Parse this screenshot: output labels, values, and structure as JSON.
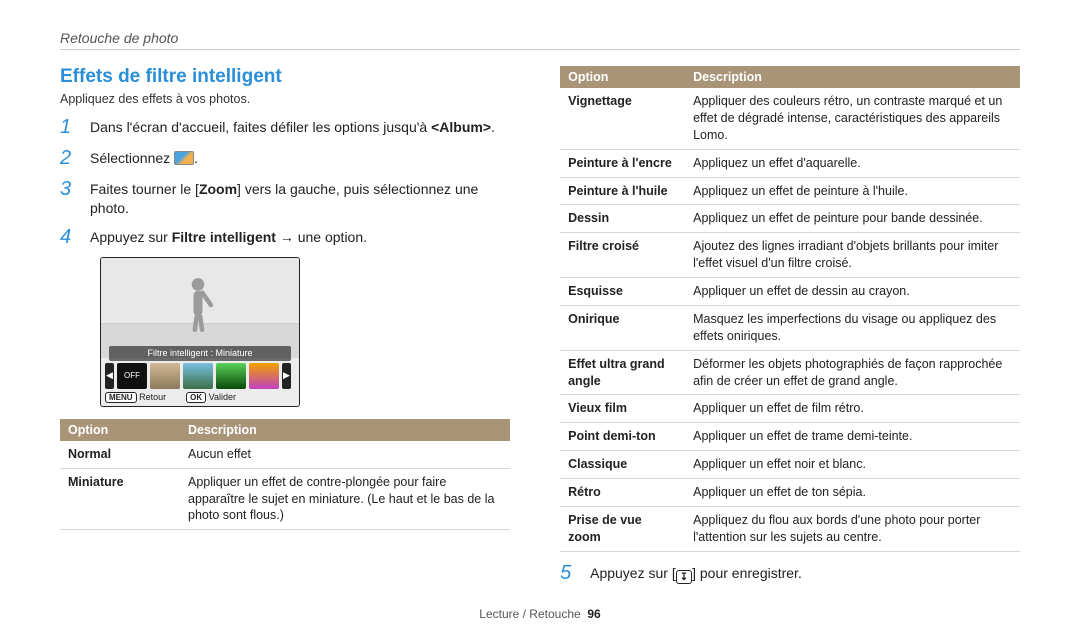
{
  "breadcrumb": "Retouche de photo",
  "heading": "Effets de filtre intelligent",
  "subtext": "Appliquez des effets à vos photos.",
  "steps": {
    "s1_a": "Dans l'écran d'accueil, faites défiler les options jusqu'à ",
    "s1_b": "<Album>",
    "s1_c": ".",
    "s2_a": "Sélectionnez ",
    "s2_b": ".",
    "s3_a": "Faites tourner le [",
    "s3_b": "Zoom",
    "s3_c": "] vers la gauche, puis sélectionnez une photo.",
    "s4_a": "Appuyez sur ",
    "s4_b": "Filtre intelligent",
    "s4_c": " → une option.",
    "s5_a": "Appuyez sur [",
    "s5_icon": "↧",
    "s5_b": "] pour enregistrer."
  },
  "preview": {
    "strip_label": "Filtre intelligent : Miniature",
    "off": "OFF",
    "nav_left": "◀",
    "nav_right": "▶",
    "menu_pill": "MENU",
    "menu_txt": "Retour",
    "ok_pill": "OK",
    "ok_txt": "Valider"
  },
  "table_header": {
    "option": "Option",
    "description": "Description"
  },
  "table_left": [
    {
      "opt": "Normal",
      "desc": "Aucun effet"
    },
    {
      "opt": "Miniature",
      "desc": "Appliquer un effet de contre-plongée pour faire apparaître le sujet en miniature. (Le haut et le bas de la photo sont flous.)"
    }
  ],
  "table_right": [
    {
      "opt": "Vignettage",
      "desc": "Appliquer des couleurs rétro, un contraste marqué et un effet de dégradé intense, caractéristiques des appareils Lomo."
    },
    {
      "opt": "Peinture à l'encre",
      "desc": "Appliquez un effet d'aquarelle."
    },
    {
      "opt": "Peinture à l'huile",
      "desc": "Appliquez un effet de peinture à l'huile."
    },
    {
      "opt": "Dessin",
      "desc": "Appliquez un effet de peinture pour bande dessinée."
    },
    {
      "opt": "Filtre croisé",
      "desc": "Ajoutez des lignes irradiant d'objets brillants pour imiter l'effet visuel d'un filtre croisé."
    },
    {
      "opt": "Esquisse",
      "desc": "Appliquer un effet de dessin au crayon."
    },
    {
      "opt": "Onirique",
      "desc": "Masquez les imperfections du visage ou appliquez des effets oniriques."
    },
    {
      "opt": "Effet ultra grand angle",
      "desc": "Déformer les objets photographiés de façon rapprochée afin de créer un effet de grand angle."
    },
    {
      "opt": "Vieux film",
      "desc": "Appliquer un effet de film rétro."
    },
    {
      "opt": "Point demi-ton",
      "desc": "Appliquer un effet de trame demi-teinte."
    },
    {
      "opt": "Classique",
      "desc": "Appliquer un effet noir et blanc."
    },
    {
      "opt": "Rétro",
      "desc": "Appliquer un effet de ton sépia."
    },
    {
      "opt": "Prise de vue zoom",
      "desc": "Appliquez du flou aux bords d'une photo pour porter l'attention sur les sujets au centre."
    }
  ],
  "footer": {
    "section": "Lecture / Retouche",
    "page": "96"
  }
}
